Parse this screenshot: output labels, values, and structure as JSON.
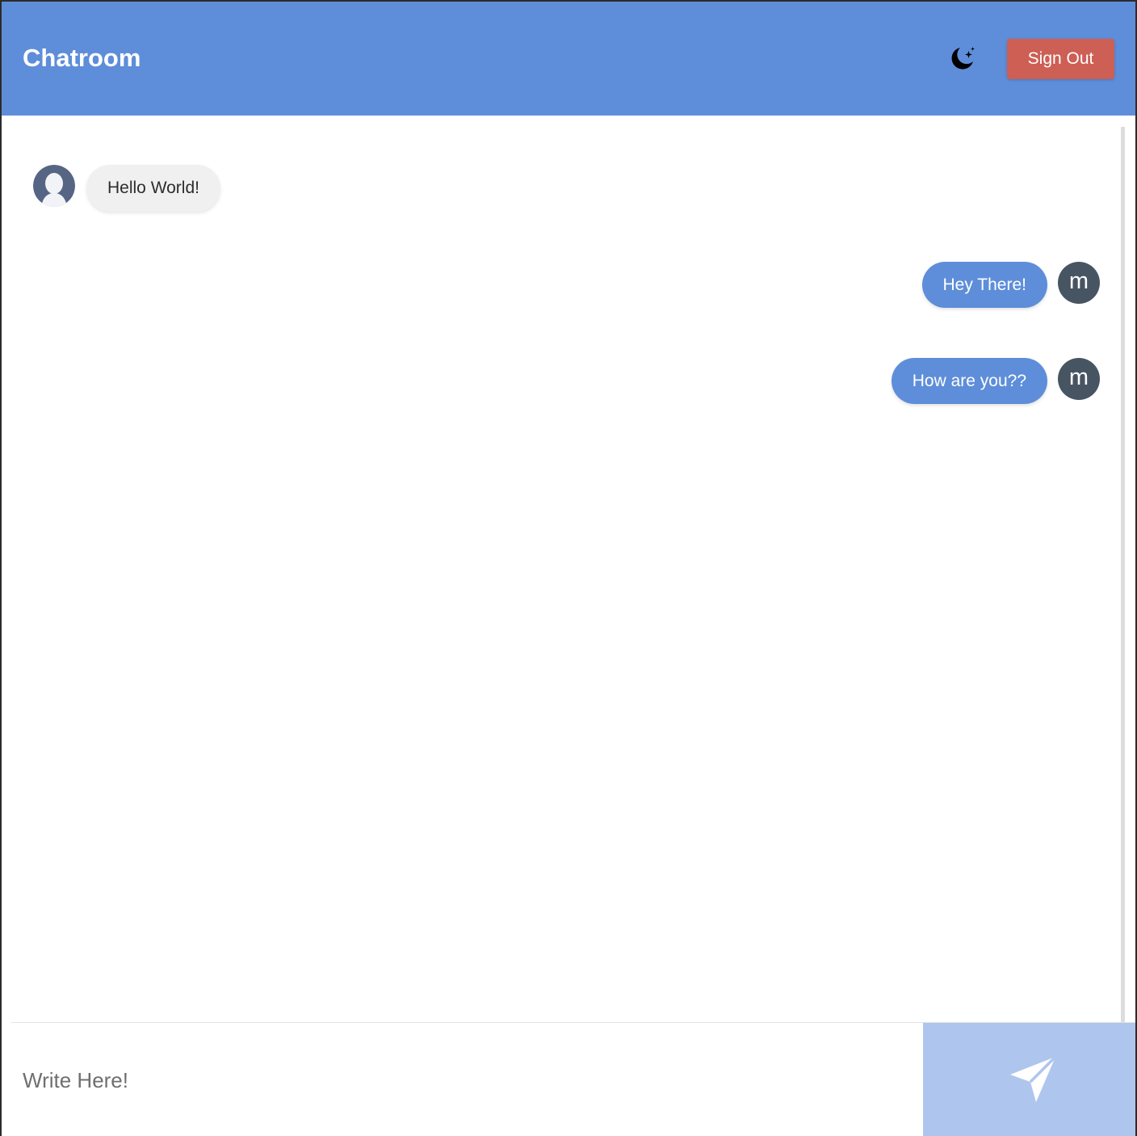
{
  "header": {
    "title": "Chatroom",
    "signout_label": "Sign Out",
    "theme_icon": "moon-stars-icon"
  },
  "messages": [
    {
      "text": "Hello World!",
      "direction": "received",
      "avatar": "default-user-icon"
    },
    {
      "text": "Hey There!",
      "direction": "sent",
      "avatar_letter": "m"
    },
    {
      "text": "How are you??",
      "direction": "sent",
      "avatar_letter": "m"
    }
  ],
  "composer": {
    "placeholder": "Write Here!",
    "send_icon": "paper-plane-icon"
  },
  "colors": {
    "header": "#5e8ed9",
    "signout": "#cd5f55",
    "sent_bubble": "#5e8ed9",
    "received_bubble": "#f0f0f0",
    "letter_avatar": "#475563",
    "send_button": "#aec6ed"
  }
}
